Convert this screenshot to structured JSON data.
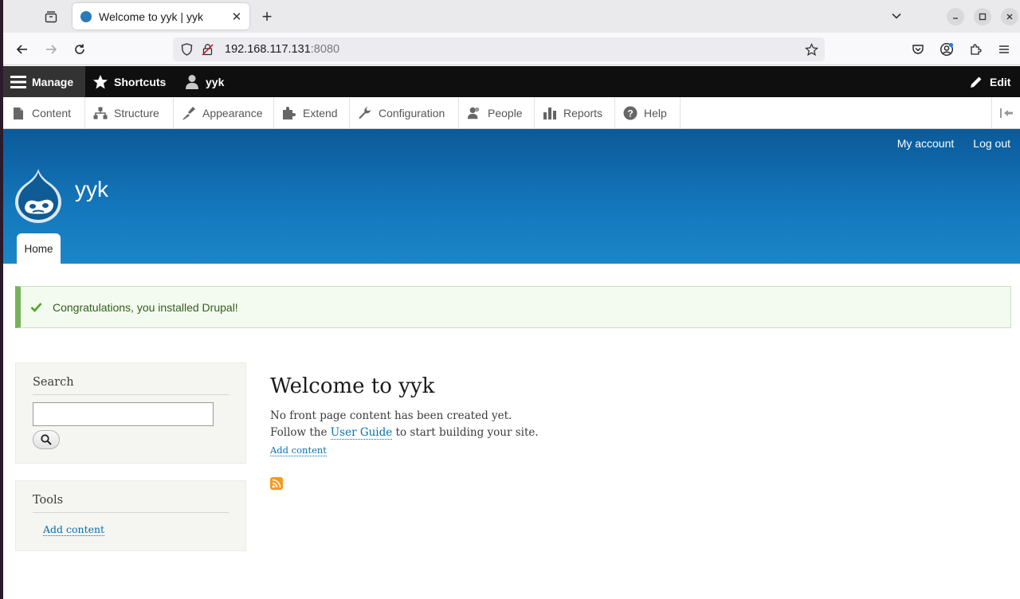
{
  "browser": {
    "tab_title": "Welcome to yyk | yyk",
    "tab_close": "✕",
    "new_tab": "+",
    "url_host": "192.168.117.131",
    "url_port": ":8080"
  },
  "admin_toolbar": {
    "manage": "Manage",
    "shortcuts": "Shortcuts",
    "user": "yyk",
    "edit": "Edit"
  },
  "admin_tray": {
    "items": [
      {
        "label": "Content",
        "icon": "document-icon"
      },
      {
        "label": "Structure",
        "icon": "structure-icon"
      },
      {
        "label": "Appearance",
        "icon": "paintbrush-icon"
      },
      {
        "label": "Extend",
        "icon": "puzzle-icon"
      },
      {
        "label": "Configuration",
        "icon": "wrench-icon"
      },
      {
        "label": "People",
        "icon": "people-icon"
      },
      {
        "label": "Reports",
        "icon": "bar-chart-icon"
      },
      {
        "label": "Help",
        "icon": "help-icon"
      }
    ]
  },
  "header": {
    "secondary_menu": [
      "My account",
      "Log out"
    ],
    "site_name": "yyk",
    "primary_tab": "Home"
  },
  "message": {
    "text": "Congratulations, you installed Drupal!"
  },
  "sidebar": {
    "search_title": "Search",
    "search_value": "",
    "tools_title": "Tools",
    "tools_link": "Add content"
  },
  "main": {
    "title": "Welcome to yyk",
    "line1": "No front page content has been created yet.",
    "line2_before": "Follow the ",
    "line2_link": "User Guide",
    "line2_after": " to start building your site.",
    "add_content": "Add content"
  },
  "colors": {
    "header_top": "#0b5a99",
    "header_bottom": "#1b86c8",
    "toolbar": "#0f0f0f",
    "link": "#0071b3",
    "status_green": "#77b259",
    "rss_orange": "#f39b1a"
  }
}
